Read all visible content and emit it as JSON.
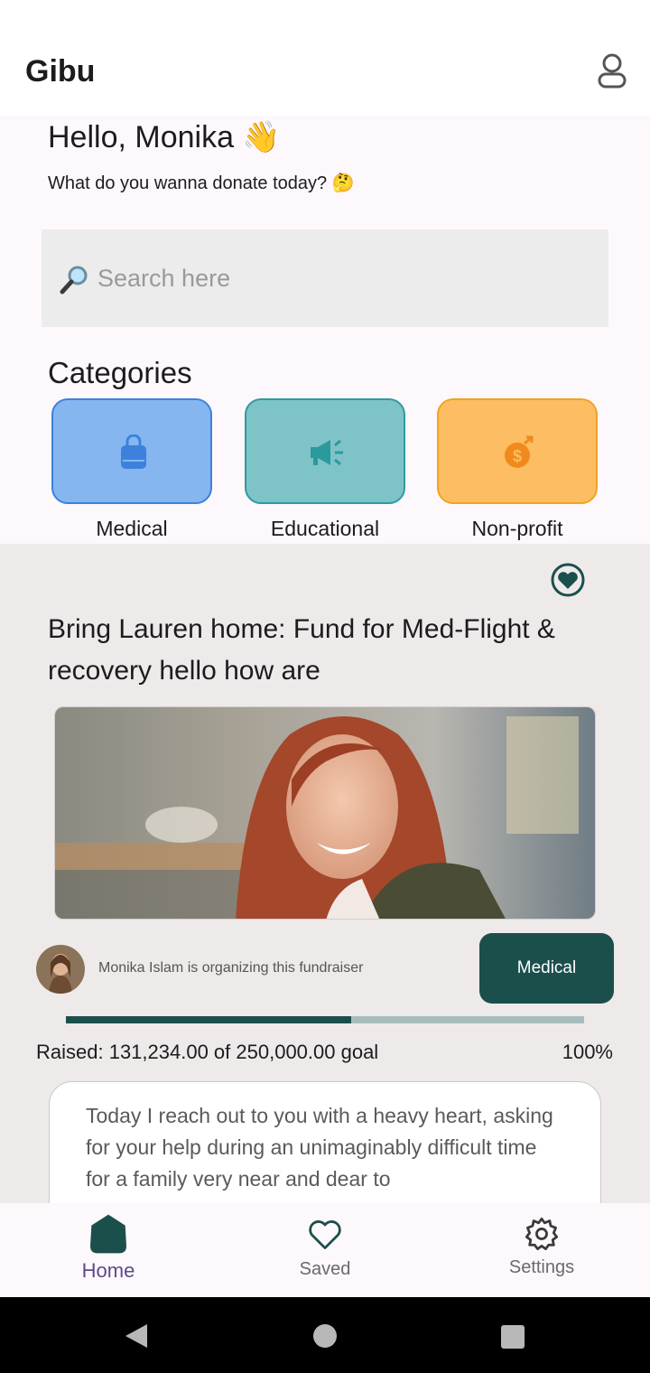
{
  "app": {
    "title": "Gibu"
  },
  "greeting": {
    "title": "Hello, Monika 👋",
    "subtitle": "What do you wanna donate today? 🤔"
  },
  "search": {
    "placeholder": "Search here",
    "icon": "magnifier-icon"
  },
  "categories": {
    "heading": "Categories",
    "items": [
      {
        "label": "Medical",
        "icon": "medical-bag-icon",
        "bg": "#85b6f0",
        "border": "#3c82dc",
        "icon_color": "#3c82dc"
      },
      {
        "label": "Educational",
        "icon": "megaphone-icon",
        "bg": "#7ec3c7",
        "border": "#2f9aa0",
        "icon_color": "#2a9a9f"
      },
      {
        "label": "Non-profit",
        "icon": "money-bag-icon",
        "bg": "#fdbd62",
        "border": "#f1a323",
        "icon_color": "#f08a1c"
      }
    ]
  },
  "fundraiser": {
    "title": "Bring Lauren home: Fund for Med-Flight & recovery hello how are",
    "organizer": "Monika Islam is organizing this fundraiser",
    "tag": "Medical",
    "progress_fraction": 0.55,
    "raised_text": "Raised: 131,234.00 of 250,000.00 goal",
    "percent_text": "100%",
    "story": "Today I reach out to you with a heavy heart, asking for your help during an unimaginably difficult time for a family very near and dear to"
  },
  "nav": {
    "items": [
      {
        "label": "Home",
        "icon": "home-icon",
        "active": true
      },
      {
        "label": "Saved",
        "icon": "heart-outline-icon",
        "active": false
      },
      {
        "label": "Settings",
        "icon": "gear-icon",
        "active": false
      }
    ]
  },
  "colors": {
    "primary": "#1b4f4c",
    "accent": "#5c4a8a"
  }
}
